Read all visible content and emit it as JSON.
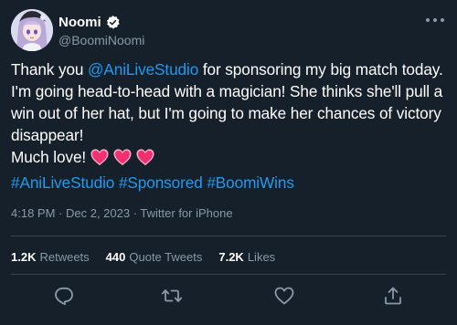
{
  "colors": {
    "background": "#15202b",
    "link": "#1d9bf0",
    "secondary_text": "#8b98a5",
    "divider": "#38444d",
    "heart": "#f91880"
  },
  "author": {
    "display_name": "Noomi",
    "handle": "@BoomiNoomi",
    "verified": true,
    "avatar_icon": "anime-avatar"
  },
  "tweet": {
    "text_segments": [
      {
        "text": "Thank you ",
        "type": "text"
      },
      {
        "text": "@AniLiveStudio",
        "type": "mention"
      },
      {
        "text": " for sponsoring my big match today. I'm going head-to-head with a magician! She thinks she'll pull a win out of her hat, but I'm going to make her chances of victory disappear!",
        "type": "text"
      }
    ],
    "closing_line": "Much love!",
    "emoji": [
      "heart-icon",
      "heart-icon",
      "heart-icon"
    ],
    "hashtags": [
      "#AniLiveStudio",
      "#Sponsored",
      "#BoomiWins"
    ]
  },
  "meta": {
    "time": "4:18 PM",
    "date": "Dec 2, 2023",
    "source": "Twitter for iPhone",
    "separator": " · "
  },
  "stats": {
    "retweets_count": "1.2K",
    "retweets_label": "Retweets",
    "quotes_count": "440",
    "quotes_label": "Quote Tweets",
    "likes_count": "7.2K",
    "likes_label": "Likes"
  },
  "actions": [
    "reply-icon",
    "retweet-icon",
    "like-icon",
    "share-icon"
  ]
}
